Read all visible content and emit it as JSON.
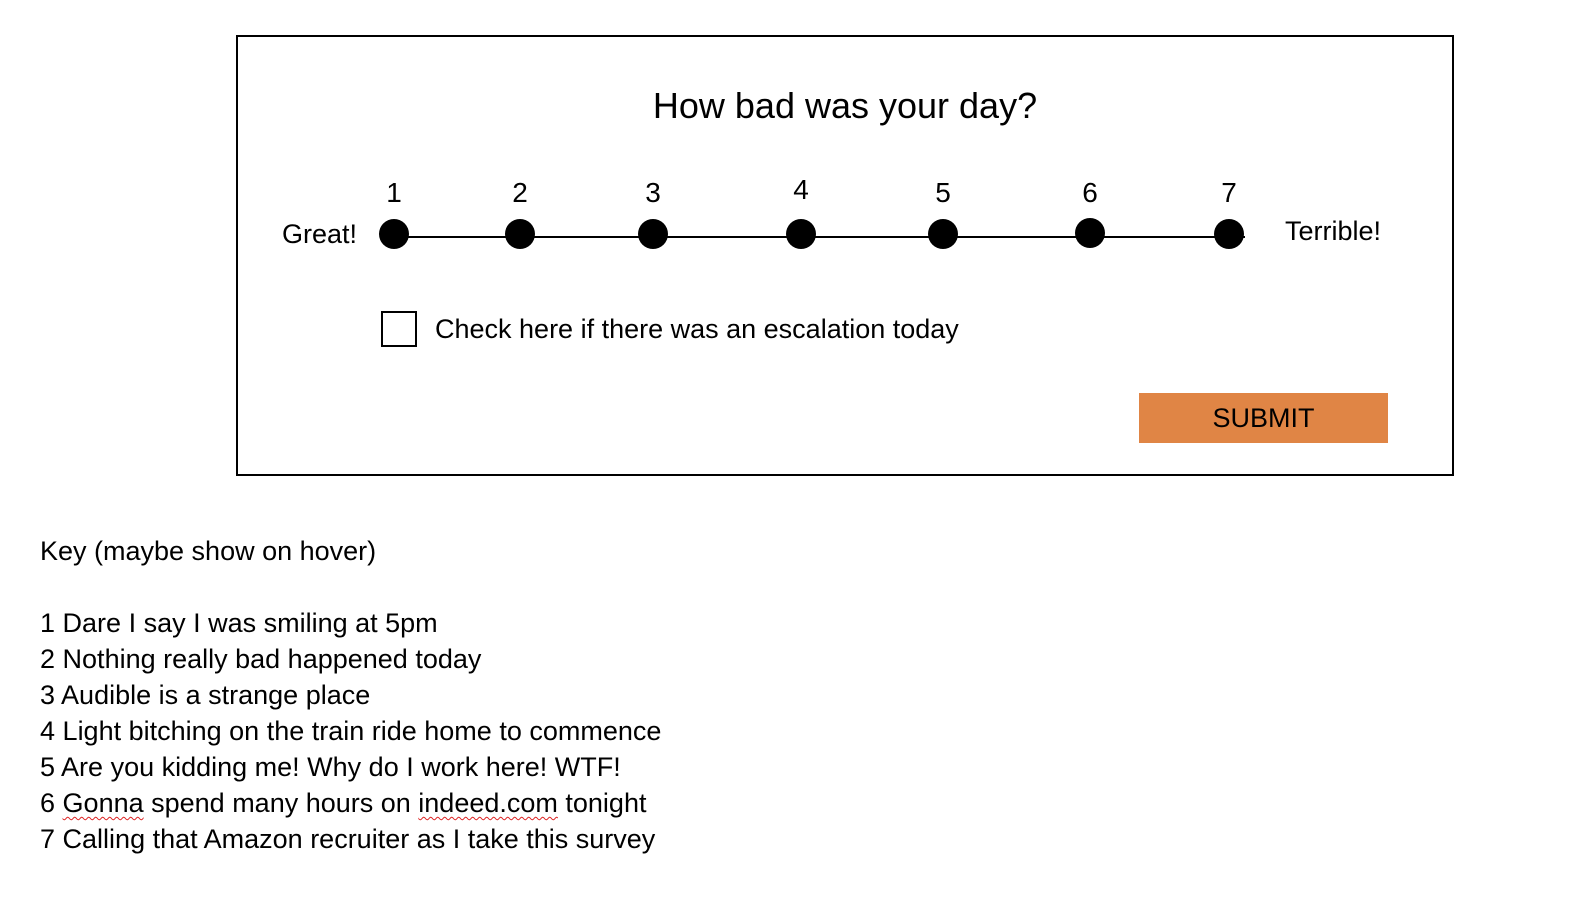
{
  "survey": {
    "title": "How bad was your day?",
    "label_left": "Great!",
    "label_right": "Terrible!",
    "points": [
      "1",
      "2",
      "3",
      "4",
      "5",
      "6",
      "7"
    ],
    "checkbox_label": "Check here if there was an escalation today",
    "submit_label": "SUBMIT",
    "submit_color": "#e08545"
  },
  "key": {
    "heading": "Key (maybe show on hover)",
    "items": [
      {
        "num": "1",
        "pre": "Dare I say I was smiling at 5pm",
        "mis1": "",
        "mid": "",
        "mis2": "",
        "post": ""
      },
      {
        "num": "2",
        "pre": "Nothing really bad happened today",
        "mis1": "",
        "mid": "",
        "mis2": "",
        "post": ""
      },
      {
        "num": "3",
        "pre": "Audible is a strange place",
        "mis1": "",
        "mid": "",
        "mis2": "",
        "post": ""
      },
      {
        "num": "4",
        "pre": "Light bitching on the train ride home to commence",
        "mis1": "",
        "mid": "",
        "mis2": "",
        "post": ""
      },
      {
        "num": "5",
        "pre": "Are you kidding me! Why do I work here! WTF!",
        "mis1": "",
        "mid": "",
        "mis2": "",
        "post": ""
      },
      {
        "num": "6",
        "pre": "",
        "mis1": "Gonna",
        "mid": " spend many hours on ",
        "mis2": "indeed.com",
        "post": " tonight"
      },
      {
        "num": "7",
        "pre": "Calling that Amazon recruiter as I take this survey",
        "mis1": "",
        "mid": "",
        "mis2": "",
        "post": ""
      }
    ]
  }
}
